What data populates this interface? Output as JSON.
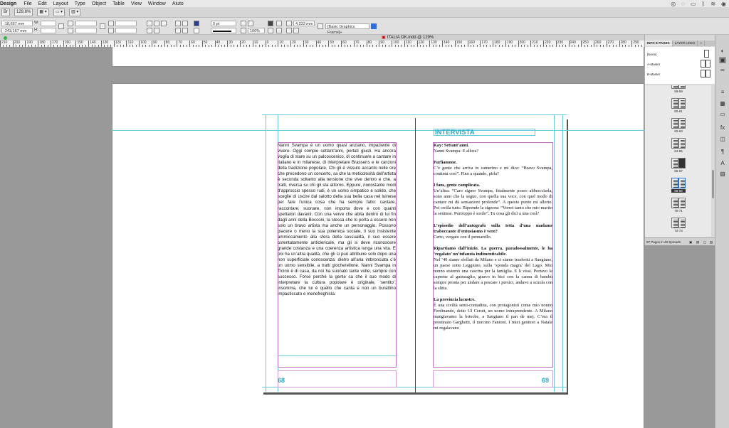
{
  "menubar": {
    "app": "Design",
    "items": [
      "File",
      "Edit",
      "Layout",
      "Type",
      "Object",
      "Table",
      "View",
      "Window",
      "Aiuto"
    ]
  },
  "appbar": {
    "zoom": "129,8%"
  },
  "control": {
    "x_value": "-18,697 mm",
    "y_value": "-243,167 mm",
    "x_label": "X:",
    "y_label": "Y:",
    "w_label": "W:",
    "h_label": "H:",
    "stroke_weight": "0 pt",
    "opacity": "100%",
    "offset": "4,233 mm",
    "frame_style": "[Basic Graphics Frame]+"
  },
  "doc_tab": {
    "title": "ITALIA OK.indd @ 129%"
  },
  "ruler": {
    "labels": [
      "210",
      "200",
      "190",
      "180",
      "170",
      "160",
      "150",
      "140",
      "130",
      "120",
      "110",
      "100",
      "90",
      "80",
      "70",
      "60",
      "50",
      "40",
      "30",
      "20",
      "10",
      "0",
      "10",
      "20",
      "30",
      "40",
      "50",
      "60",
      "70",
      "80",
      "90",
      "100",
      "110",
      "120",
      "130",
      "140",
      "150",
      "160",
      "170",
      "180",
      "190",
      "200",
      "210",
      "220",
      "230",
      "240",
      "250",
      "260",
      "270",
      "280",
      "290"
    ]
  },
  "spread": {
    "left_page_number": "68",
    "right_page_number": "69",
    "left_text": "Nanni Svampa è un uomo quasi anziano, impaziente di vivere. Oggi compie settant’anni, portati giusti. Ha ancora voglia di stare su un palcoscenico, di continuare a cantare in italiano e in milanese, di interpretare Brassens e le canzoni della tradizione popolare. Chi gli è vissuto accanto nelle ore che precedono un concerto, sa che la meticolosità dell’artista è seconda soltanto alla tensione che vive dentro e che, a tratti, riversa su chi gli sta attorno. Eppure, nonostante modi d’approccio spesso rudi, è un uomo simpatico e solido, che sceglie di uscire dal salotto della sua bella casa nel luinese per fare l’unica cosa che ha sempre fatto: cantare, raccontare, suonare, non importa dove e con quanti spettatori davanti. Con una verve che abita dentro di lui fin dagli anni della Bocconi, la stessa che lo porta a essere non solo un bravo artista ma anche un personaggio. Possono piacere o meno la sua polemica sociale, il suo insistente ammiccamento alla sfera della sessualità, il suo essere ostentatamente anticlericale, ma gli si deve riconoscere grande costanza e una coerenza artistica lunga una vita. E poi ha un’altra qualità, che gli si può attribuire solo dopo una non superficiale conoscenza: dietro all’aria imbronciata c’è un uomo sensibile, a tratti giocherellone. Nanni Svampa in Ticino è di casa, da noi ha suonato tante volte, sempre con successo. Forse perché la gente sa che il suo modo di interpretare la cultura popolare è originale, ‘sentito’; insomma, che lui è quello che canta e non un burattino impasticcato e menefreghista.",
    "heading": "INTERVISTA",
    "interview": [
      {
        "q": "Kay: Settant’anni.",
        "a": "Nanni Svampa: E allora?"
      },
      {
        "q": "Parliamone.",
        "a": "C’è gente che arriva in camerino e mi dice: “Bravo Svampa, continui così”. Fino a quando, pirla?"
      },
      {
        "q": "I fans, gente complicata.",
        "a": "Un’altra: “Caro signor Svampa, finalmente posso abbracciarla, sono anni che la seguo, con quella sua voce, con quel modo di cantare mi dà sensazioni profonde”. A questo punto mi allerto. Poi crolla tutto. Riprende la signora: “Vorrei tanto che mio marito la sentisse. Purtroppo è sordo”. Tu cosa gli dici a una così?"
      },
      {
        "q": "L’episodio dell’autografo sulla tetta d’una madame traboccante d’entusiasmo è vero?",
        "a": "Certo, vergato con il pennarello."
      },
      {
        "q": "Ripartiamo dall’inizio. La guerra, paradossalmente, le ha ‘regalato’ un’infanzia indimenticabile.",
        "a": "Nel ’40 siamo sfollati da Milano e ci siamo trasferiti a Sangiano, un paese sotto Leggiuno, sulla ‘sponda magra’ del Lago. Mio nonno sistemò una cascina per la famiglia. E li vissi. Portavo le caprette al guinzaglio, giravo in bici con la canna di bambù sempre pronta per andare a pescare i persici, andavo a scuola con la slitta."
      },
      {
        "q": "La provincia lacustre.",
        "a": "È una civiltà semi-contadina, con protagonisti come mio nonno Ferdinando, detto Ul Cerutt, un uomo intraprendente. A Milano mangiavamo la brioche, a Sangiano il pan de mej. C’era il prestinaio Garghetti, il norcino Fantoni. I miei genitori a Natale mi regalavano"
      }
    ]
  },
  "pages_panel": {
    "tabs": [
      "INFO E PAGES",
      "LAYER LINKS",
      "»"
    ],
    "masters": [
      "[None]",
      "A-Master",
      "B-Master"
    ],
    "spreads": [
      {
        "label": "58-59"
      },
      {
        "label": "60-61"
      },
      {
        "label": "62-63"
      },
      {
        "label": "64-65"
      },
      {
        "label": "66-67"
      },
      {
        "label": "68-69",
        "selected": true
      },
      {
        "label": "70-71"
      },
      {
        "label": "72-73"
      }
    ],
    "status": "97 Pages in 49 Spreads"
  },
  "tools": [
    "page-icon",
    "layers-icon",
    "links-icon",
    "stroke-icon",
    "swatches-icon",
    "gradient-icon",
    "align-icon",
    "effects-icon",
    "object-styles-icon",
    "paragraph-styles-icon",
    "character-styles-icon",
    "text-wrap-icon"
  ]
}
